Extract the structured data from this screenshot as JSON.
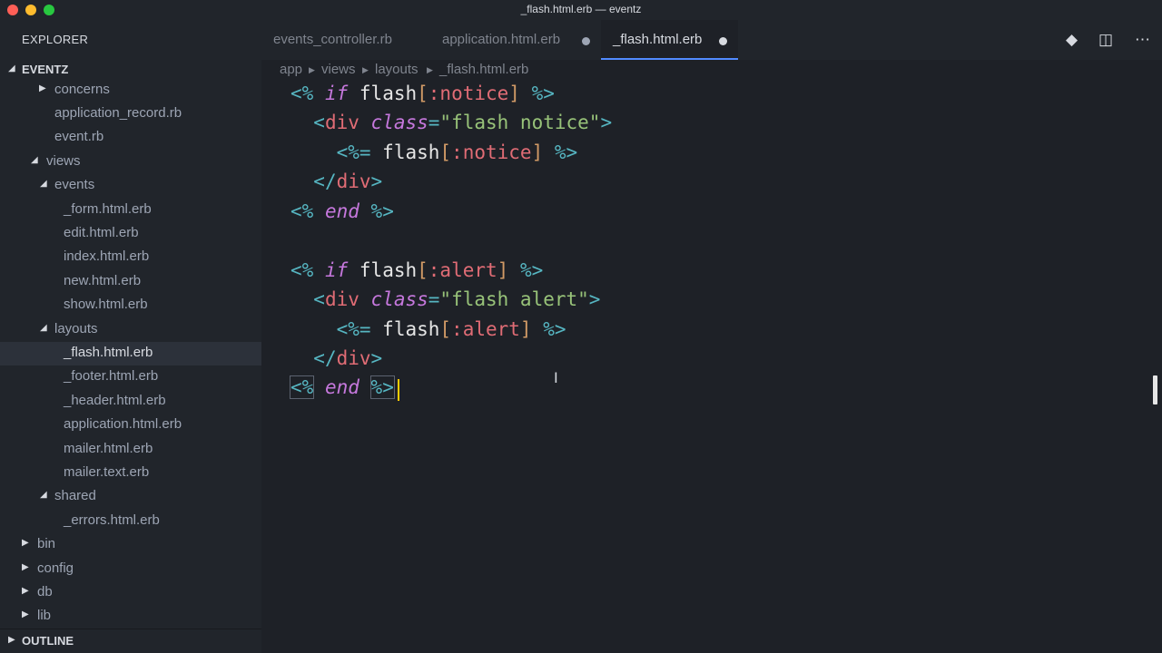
{
  "window": {
    "title": "_flash.html.erb — eventz"
  },
  "sidebar": {
    "title": "EXPLORER",
    "project": "EVENTZ",
    "items": [
      {
        "label": "concerns"
      },
      {
        "label": "application_record.rb"
      },
      {
        "label": "event.rb"
      },
      {
        "label": "views"
      },
      {
        "label": "events"
      },
      {
        "label": "_form.html.erb"
      },
      {
        "label": "edit.html.erb"
      },
      {
        "label": "index.html.erb"
      },
      {
        "label": "new.html.erb"
      },
      {
        "label": "show.html.erb"
      },
      {
        "label": "layouts"
      },
      {
        "label": "_flash.html.erb"
      },
      {
        "label": "_footer.html.erb"
      },
      {
        "label": "_header.html.erb"
      },
      {
        "label": "application.html.erb"
      },
      {
        "label": "mailer.html.erb"
      },
      {
        "label": "mailer.text.erb"
      },
      {
        "label": "shared"
      },
      {
        "label": "_errors.html.erb"
      },
      {
        "label": "bin"
      },
      {
        "label": "config"
      },
      {
        "label": "db"
      },
      {
        "label": "lib"
      }
    ],
    "outline": "OUTLINE"
  },
  "tabs": [
    {
      "label": "events_controller.rb",
      "modified": false
    },
    {
      "label": "application.html.erb",
      "modified": true
    },
    {
      "label": "_flash.html.erb",
      "modified": true,
      "active": true
    }
  ],
  "breadcrumb": [
    "app",
    "views",
    "layouts",
    "_flash.html.erb"
  ],
  "code": {
    "l1": {
      "open": "<%",
      "kw": "if",
      "ident": "flash",
      "lb": "[",
      "sym": ":notice",
      "rb": "]",
      "close": "%>"
    },
    "l2": {
      "lt": "<",
      "tag": "div",
      "attr": "class",
      "eq": "=",
      "str": "\"flash notice\"",
      "gt": ">"
    },
    "l3": {
      "open": "<%=",
      "ident": "flash",
      "lb": "[",
      "sym": ":notice",
      "rb": "]",
      "close": "%>"
    },
    "l4": {
      "lt": "</",
      "tag": "div",
      "gt": ">"
    },
    "l5": {
      "open": "<%",
      "kw": "end",
      "close": "%>"
    },
    "l7": {
      "open": "<%",
      "kw": "if",
      "ident": "flash",
      "lb": "[",
      "sym": ":alert",
      "rb": "]",
      "close": "%>"
    },
    "l8": {
      "lt": "<",
      "tag": "div",
      "attr": "class",
      "eq": "=",
      "str": "\"flash alert\"",
      "gt": ">"
    },
    "l9": {
      "open": "<%=",
      "ident": "flash",
      "lb": "[",
      "sym": ":alert",
      "rb": "]",
      "close": "%>"
    },
    "l10": {
      "lt": "</",
      "tag": "div",
      "gt": ">"
    },
    "l11": {
      "open": "<%",
      "kw": "end",
      "close": "%>"
    }
  }
}
